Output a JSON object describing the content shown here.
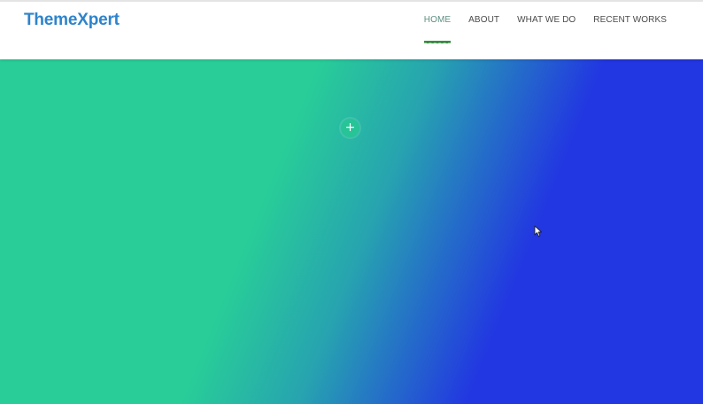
{
  "header": {
    "logo": "ThemeXpert"
  },
  "nav": {
    "items": [
      {
        "label": "HOME",
        "active": true
      },
      {
        "label": "ABOUT",
        "active": false
      },
      {
        "label": "WHAT WE DO",
        "active": false
      },
      {
        "label": "RECENT WORKS",
        "active": false
      }
    ]
  },
  "hero": {
    "add_button_label": "+",
    "icons": {
      "add": "plus-icon",
      "cursor": "mouse-cursor-icon"
    }
  },
  "colors": {
    "logo": "#2d84cc",
    "nav_text": "#4a4a4a",
    "nav_active": "#5f8f82",
    "nav_underline": "#3b8a45",
    "gradient_green": "#28cd98",
    "gradient_teal": "#27a3b0",
    "gradient_blue": "#2236e2",
    "add_button": "#26c496"
  }
}
